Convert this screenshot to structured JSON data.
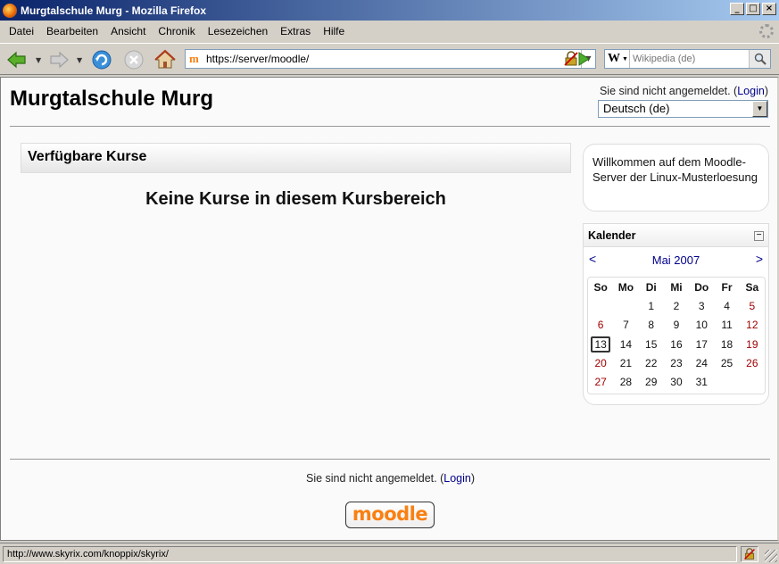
{
  "window": {
    "title": "Murgtalschule Murg - Mozilla Firefox",
    "minimize": "_",
    "maximize": "□",
    "close": "×"
  },
  "menu": [
    "Datei",
    "Bearbeiten",
    "Ansicht",
    "Chronik",
    "Lesezeichen",
    "Extras",
    "Hilfe"
  ],
  "toolbar": {
    "url": "https://server/moodle/",
    "site_icon": "m",
    "search_engine_label": "W",
    "search_placeholder": "Wikipedia (de)"
  },
  "page": {
    "site_title": "Murgtalschule Murg",
    "login_prefix": "Sie sind nicht angemeldet. (",
    "login_link": "Login",
    "login_suffix": ")",
    "language": "Deutsch (de)",
    "courses_heading": "Verfügbare Kurse",
    "no_courses": "Keine Kurse in diesem Kursbereich",
    "welcome_text": "Willkommen auf dem Moodle-Server der Linux-Musterloesung",
    "footer_login_prefix": "Sie sind nicht angemeldet. (",
    "footer_login_link": "Login",
    "footer_login_suffix": ")",
    "moodle_logo_text": "moodle"
  },
  "calendar": {
    "title": "Kalender",
    "toggle": "−",
    "prev": "<",
    "next": ">",
    "month": "Mai 2007",
    "weekdays": [
      "So",
      "Mo",
      "Di",
      "Mi",
      "Do",
      "Fr",
      "Sa"
    ],
    "weeks": [
      [
        "",
        "",
        "1",
        "2",
        "3",
        "4",
        "5"
      ],
      [
        "6",
        "7",
        "8",
        "9",
        "10",
        "11",
        "12"
      ],
      [
        "13",
        "14",
        "15",
        "16",
        "17",
        "18",
        "19"
      ],
      [
        "20",
        "21",
        "22",
        "23",
        "24",
        "25",
        "26"
      ],
      [
        "27",
        "28",
        "29",
        "30",
        "31",
        "",
        ""
      ]
    ],
    "today": "13",
    "weekend_color": "#a00000"
  },
  "status": {
    "text": "http://www.skyrix.com/knoppix/skyrix/"
  },
  "colors": {
    "titlebar_start": "#0a246a",
    "link": "#00008b",
    "moodle_orange": "#f98012"
  }
}
